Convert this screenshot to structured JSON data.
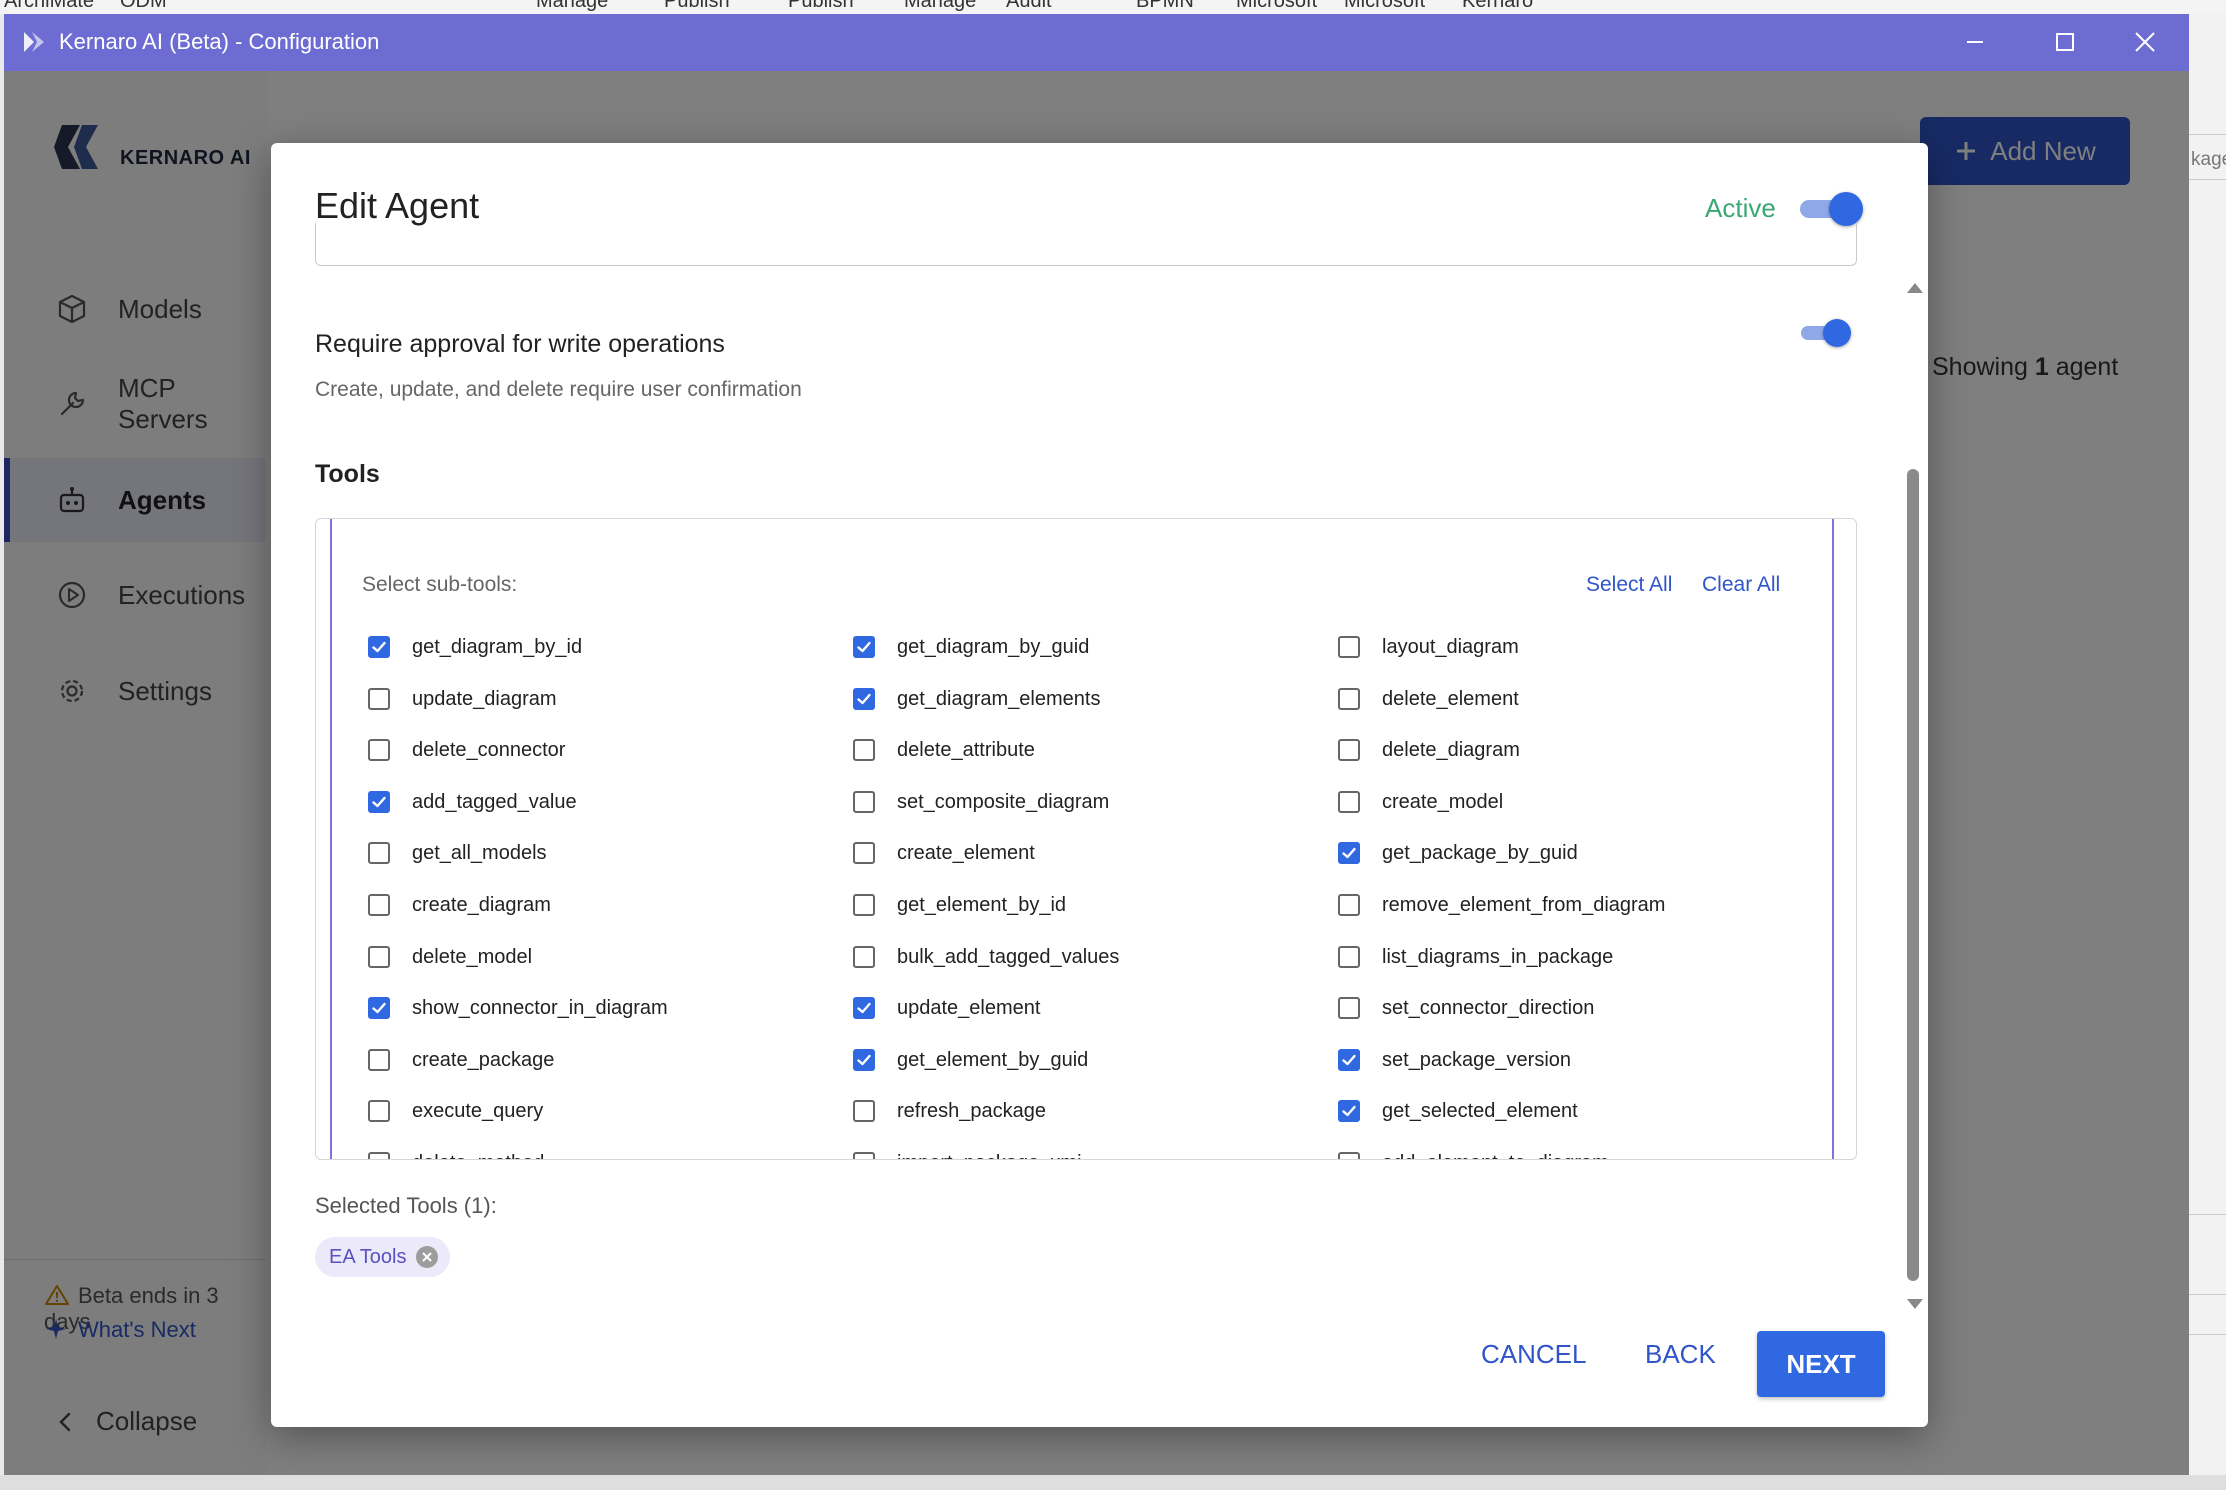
{
  "host_strip": [
    "ArchiMate",
    "ODM",
    "Manage",
    "Publish",
    "Publish",
    "Manage",
    "Audit",
    "BPMN",
    "Microsoft",
    "Microsoft",
    "Kernaro"
  ],
  "window": {
    "title": "Kernaro AI (Beta) - Configuration"
  },
  "logo_text": "KERNARO AI",
  "sidebar": {
    "items": [
      {
        "label": "Models",
        "icon": "cube-icon",
        "active": false
      },
      {
        "label": "MCP Servers",
        "icon": "wrench-icon",
        "active": false
      },
      {
        "label": "Agents",
        "icon": "robot-icon",
        "active": true
      },
      {
        "label": "Executions",
        "icon": "play-circle-icon",
        "active": false
      },
      {
        "label": "Settings",
        "icon": "gear-icon",
        "active": false
      }
    ],
    "beta_notice": "Beta ends in 3 days",
    "whats_next": "What's Next",
    "collapse": "Collapse"
  },
  "main": {
    "add_new": "Add New",
    "showing_prefix": "Showing",
    "showing_count": "1",
    "showing_suffix": "agent",
    "right_fragment": "kage"
  },
  "dialog": {
    "title": "Edit Agent",
    "active_label": "Active",
    "active_on": true,
    "approval": {
      "title": "Require approval for write operations",
      "subtitle": "Create, update, and delete require user confirmation",
      "on": true
    },
    "tools_heading": "Tools",
    "subtools_label": "Select sub-tools:",
    "select_all": "Select All",
    "clear_all": "Clear All",
    "subtools": [
      [
        {
          "name": "get_diagram_by_id",
          "checked": true
        },
        {
          "name": "get_diagram_by_guid",
          "checked": true
        },
        {
          "name": "layout_diagram",
          "checked": false
        }
      ],
      [
        {
          "name": "update_diagram",
          "checked": false
        },
        {
          "name": "get_diagram_elements",
          "checked": true
        },
        {
          "name": "delete_element",
          "checked": false
        }
      ],
      [
        {
          "name": "delete_connector",
          "checked": false
        },
        {
          "name": "delete_attribute",
          "checked": false
        },
        {
          "name": "delete_diagram",
          "checked": false
        }
      ],
      [
        {
          "name": "add_tagged_value",
          "checked": true
        },
        {
          "name": "set_composite_diagram",
          "checked": false
        },
        {
          "name": "create_model",
          "checked": false
        }
      ],
      [
        {
          "name": "get_all_models",
          "checked": false
        },
        {
          "name": "create_element",
          "checked": false
        },
        {
          "name": "get_package_by_guid",
          "checked": true
        }
      ],
      [
        {
          "name": "create_diagram",
          "checked": false
        },
        {
          "name": "get_element_by_id",
          "checked": false
        },
        {
          "name": "remove_element_from_diagram",
          "checked": false
        }
      ],
      [
        {
          "name": "delete_model",
          "checked": false
        },
        {
          "name": "bulk_add_tagged_values",
          "checked": false
        },
        {
          "name": "list_diagrams_in_package",
          "checked": false
        }
      ],
      [
        {
          "name": "show_connector_in_diagram",
          "checked": true
        },
        {
          "name": "update_element",
          "checked": true
        },
        {
          "name": "set_connector_direction",
          "checked": false
        }
      ],
      [
        {
          "name": "create_package",
          "checked": false
        },
        {
          "name": "get_element_by_guid",
          "checked": true
        },
        {
          "name": "set_package_version",
          "checked": true
        }
      ],
      [
        {
          "name": "execute_query",
          "checked": false
        },
        {
          "name": "refresh_package",
          "checked": false
        },
        {
          "name": "get_selected_element",
          "checked": true
        }
      ],
      [
        {
          "name": "delete_method",
          "checked": false
        },
        {
          "name": "import_package_xmi",
          "checked": false
        },
        {
          "name": "add_element_to_diagram",
          "checked": false
        }
      ]
    ],
    "selected_tools_label": "Selected Tools (1):",
    "selected_chips": [
      "EA Tools"
    ],
    "cancel": "CANCEL",
    "back": "BACK",
    "next": "NEXT"
  },
  "colors": {
    "titlebar": "#6c6cd2",
    "primary": "#2f68e0",
    "link": "#2f55c8",
    "active_green": "#3aa873",
    "chip_bg": "#ece9fa"
  }
}
